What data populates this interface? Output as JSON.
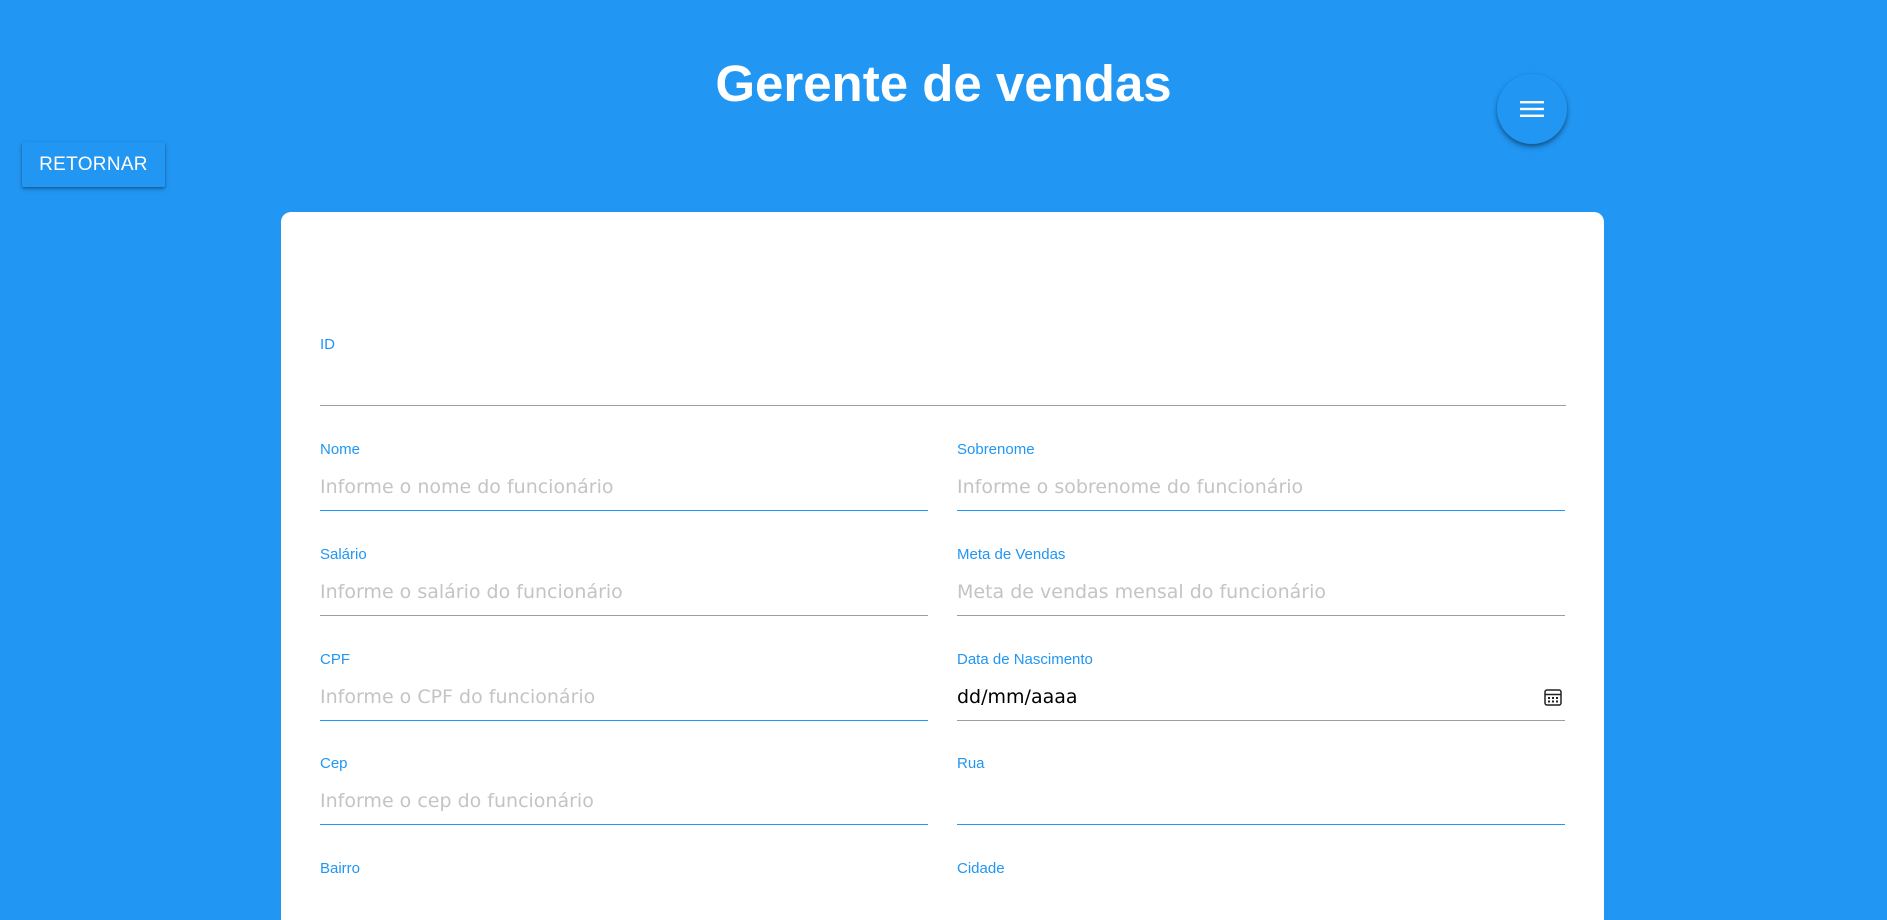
{
  "header": {
    "title": "Gerente de vendas",
    "back_button_label": "RETORNAR",
    "menu_icon": "menu-icon"
  },
  "colors": {
    "primary": "#2196F3",
    "card_background": "#ffffff",
    "placeholder": "#c4c4c4",
    "underline_inactive": "#9e9e9e"
  },
  "form": {
    "id": {
      "label": "ID",
      "value": "",
      "placeholder": ""
    },
    "nome": {
      "label": "Nome",
      "value": "",
      "placeholder": "Informe o nome do funcionário"
    },
    "sobrenome": {
      "label": "Sobrenome",
      "value": "",
      "placeholder": "Informe o sobrenome do funcionário"
    },
    "salario": {
      "label": "Salário",
      "value": "",
      "placeholder": "Informe o salário do funcionário"
    },
    "meta_vendas": {
      "label": "Meta de Vendas",
      "value": "",
      "placeholder": "Meta de vendas mensal do funcionário"
    },
    "cpf": {
      "label": "CPF",
      "value": "",
      "placeholder": "Informe o CPF do funcionário"
    },
    "data_nascimento": {
      "label": "Data de Nascimento",
      "value": "dd/mm/aaaa",
      "icon": "calendar-icon"
    },
    "cep": {
      "label": "Cep",
      "value": "",
      "placeholder": "Informe o cep do funcionário"
    },
    "rua": {
      "label": "Rua",
      "value": "",
      "placeholder": ""
    },
    "bairro": {
      "label": "Bairro"
    },
    "cidade": {
      "label": "Cidade"
    }
  }
}
